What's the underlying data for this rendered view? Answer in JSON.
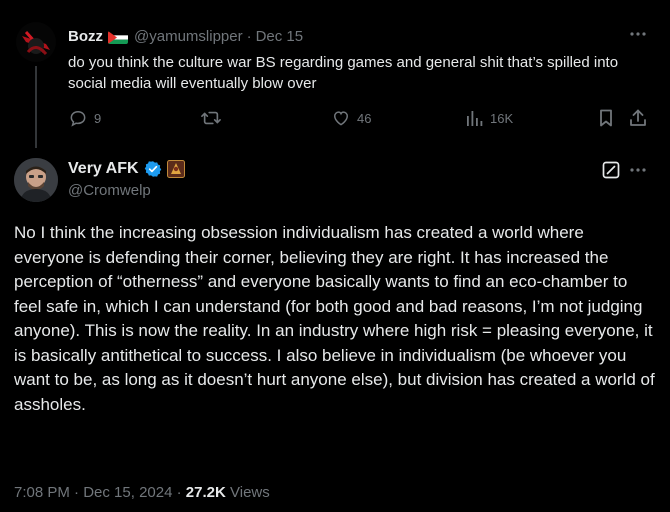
{
  "parent_tweet": {
    "author_name": "Bozz",
    "author_handle": "@yamumslipper",
    "separator": "·",
    "date": "Dec 15",
    "text": "do you think the culture war BS regarding games and general shit that’s spilled into social media will eventually blow over",
    "actions": {
      "replies": "9",
      "retweets": "",
      "likes": "46",
      "views": "16K"
    }
  },
  "main_tweet": {
    "author_name": "Very AFK",
    "author_handle": "@Cromwelp",
    "text": "No I think the increasing obsession individualism has created a world where everyone is defending their corner, believing they are right. It has increased the perception of “otherness” and everyone basically wants to find an eco-chamber to feel safe in, which I can understand (for both good and bad reasons, I’m not judging anyone). This is now the reality. In an industry where high risk = pleasing everyone, it is basically antithetical to success. I also believe in individualism (be whoever you want to be, as long as it doesn’t hurt anyone else), but division has created a world of assholes.",
    "time": "7:08 PM",
    "separator": "·",
    "date": "Dec 15, 2024",
    "separator2": "·",
    "views_count": "27.2K",
    "views_label": "Views"
  },
  "colors": {
    "background": "#000000",
    "text": "#e7e9ea",
    "muted": "#71767b",
    "verified": "#1d9bf0"
  },
  "icons": [
    "more-icon",
    "reply-icon",
    "retweet-icon",
    "like-icon",
    "views-icon",
    "bookmark-icon",
    "share-icon",
    "verified-badge-icon",
    "grok-edit-icon"
  ]
}
